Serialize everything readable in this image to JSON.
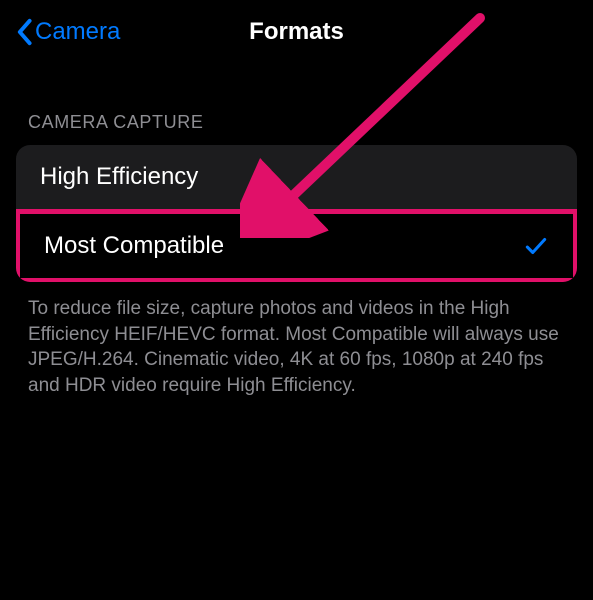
{
  "header": {
    "back_label": "Camera",
    "title": "Formats"
  },
  "section": {
    "header": "CAMERA CAPTURE",
    "options": [
      {
        "label": "High Efficiency",
        "selected": false
      },
      {
        "label": "Most Compatible",
        "selected": true
      }
    ],
    "footer": "To reduce file size, capture photos and videos in the High Efficiency HEIF/HEVC format. Most Compatible will always use JPEG/H.264. Cinematic video, 4K at 60 fps, 1080p at 240 fps and HDR video require High Efficiency."
  },
  "annotation": {
    "arrow_color": "#E11069"
  }
}
